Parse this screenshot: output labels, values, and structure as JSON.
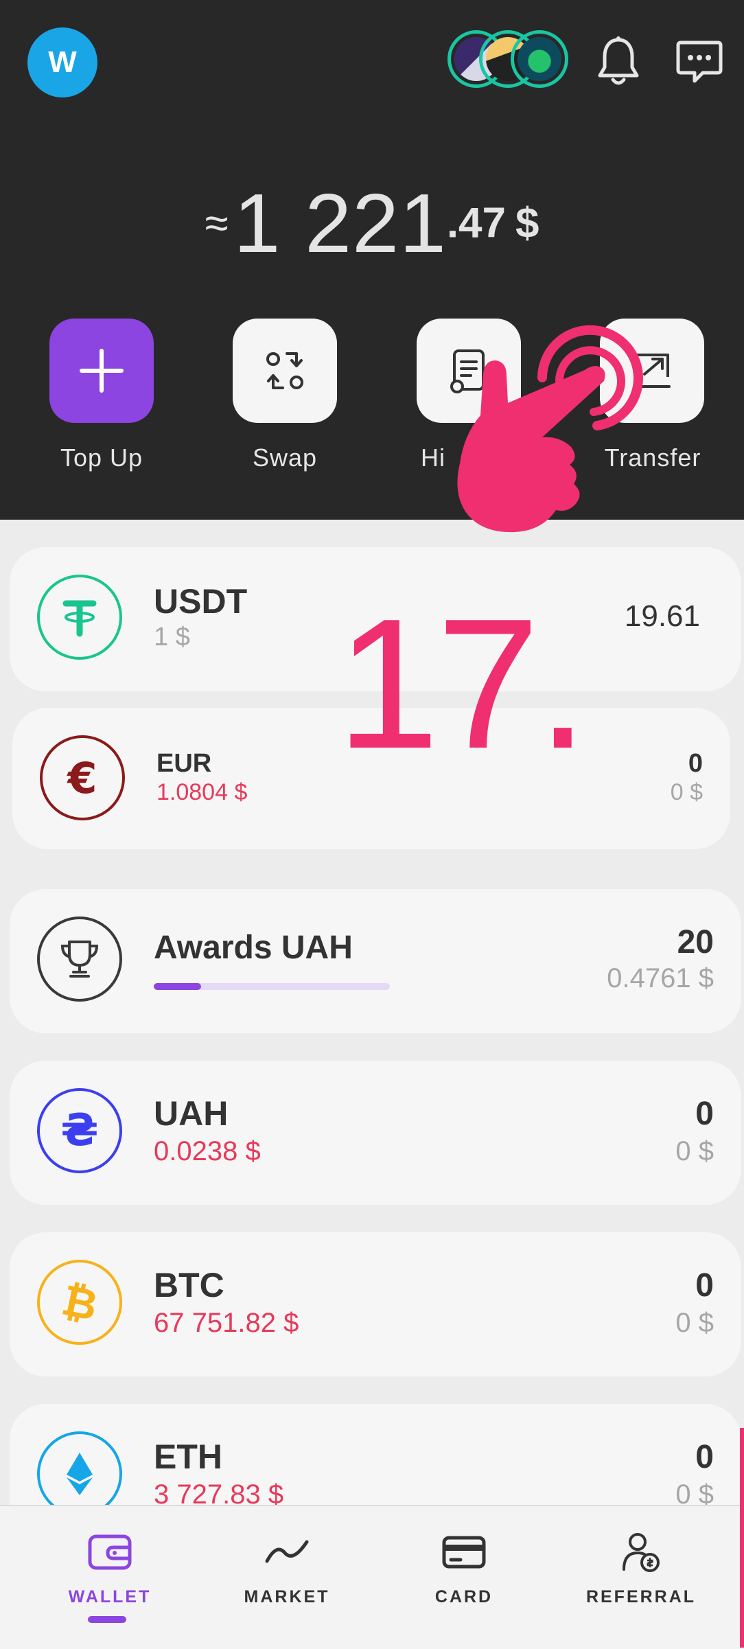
{
  "header": {
    "avatar_letter": "W",
    "balance": {
      "approx": "≈",
      "integer": "1 221",
      "decimal": ".47",
      "currency": "$"
    },
    "actions": [
      {
        "label": "Top Up",
        "icon": "plus-icon"
      },
      {
        "label": "Swap",
        "icon": "swap-icon"
      },
      {
        "label": "Hi",
        "icon": "history-icon"
      },
      {
        "label": "Transfer",
        "icon": "transfer-icon"
      }
    ]
  },
  "assets": [
    {
      "name": "USDT",
      "price": "1 $",
      "amount": "19.61",
      "usd_value": "",
      "icon": "tether-icon"
    },
    {
      "name": "EUR",
      "price": "1.0804 $",
      "amount": "0",
      "usd_value": "0 $",
      "icon": "euro-icon"
    },
    {
      "name": "Awards UAH",
      "price": "",
      "amount": "20",
      "usd_value": "0.4761 $",
      "icon": "trophy-icon",
      "progress": 0.2
    },
    {
      "name": "UAH",
      "price": "0.0238 $",
      "amount": "0",
      "usd_value": "0 $",
      "icon": "hryvnia-icon"
    },
    {
      "name": "BTC",
      "price": "67 751.82 $",
      "amount": "0",
      "usd_value": "0 $",
      "icon": "bitcoin-icon"
    },
    {
      "name": "ETH",
      "price": "3 727.83 $",
      "amount": "0",
      "usd_value": "0 $",
      "icon": "ethereum-icon"
    }
  ],
  "overlay": {
    "step_number": "17."
  },
  "nav": [
    {
      "label": "WALLET",
      "icon": "wallet-icon",
      "active": true
    },
    {
      "label": "MARKET",
      "icon": "market-icon"
    },
    {
      "label": "CARD",
      "icon": "card-icon"
    },
    {
      "label": "REFERRAL",
      "icon": "referral-icon"
    }
  ],
  "colors": {
    "accent": "#8c45e0",
    "negative": "#e8395a",
    "header_bg": "#282828",
    "annotation": "#ef2f6f"
  }
}
